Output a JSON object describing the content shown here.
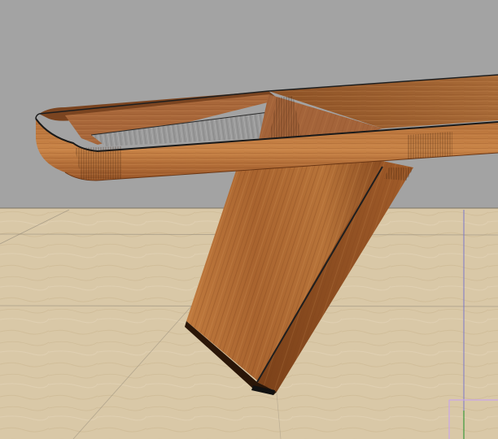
{
  "scene": {
    "subject": "coffee-table-model",
    "colors": {
      "background": "#a3a3a3",
      "floor": "#d8c7a6",
      "floor_grain": "#c7b38c",
      "wood_light": "#b5723d",
      "wood_mid": "#9a5a2b",
      "wood_dark": "#6e3a17",
      "glass": "#9b9b9b",
      "edge_line": "#1e1e1e",
      "guide_blue": "#7a78c8",
      "guide_purple": "#c9a6e8",
      "guide_green": "#3c9a3c"
    }
  }
}
